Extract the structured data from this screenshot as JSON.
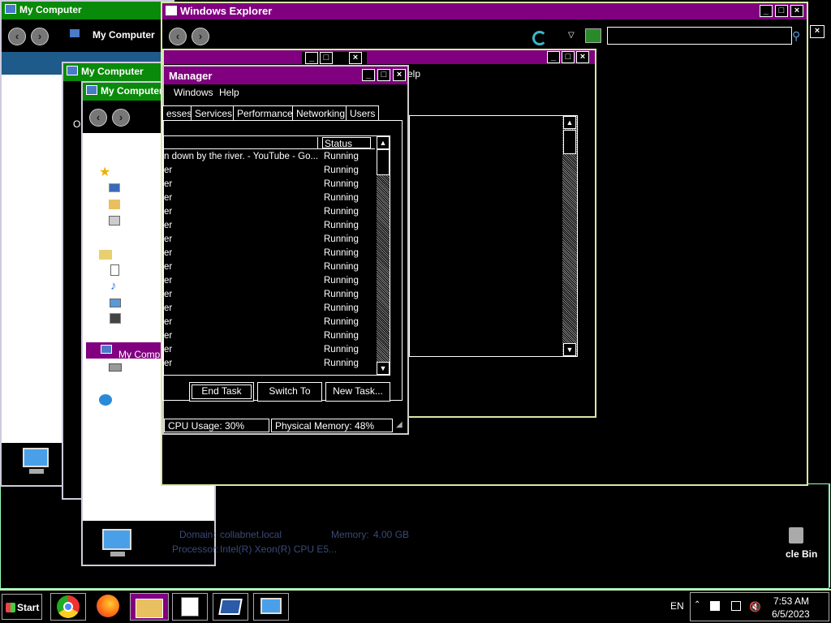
{
  "windows": {
    "back1": {
      "title": "My Computer",
      "address": "My Computer"
    },
    "back2": {
      "title": "My Computer"
    },
    "back3": {
      "title": "My Computer",
      "side_label_o": "O",
      "sidebar_selected": "My Comp"
    },
    "mid": {
      "menu_help": "elp"
    },
    "explorer": {
      "title": "Windows Explorer",
      "search_placeholder": ""
    },
    "taskmgr": {
      "title": "Manager",
      "menu": [
        "Windows",
        "Help"
      ],
      "tabs": [
        "esses",
        "Services",
        "Performance",
        "Networking",
        "Users"
      ],
      "columns": {
        "task": "",
        "status": "Status"
      },
      "rows": [
        {
          "name": "n down by the river. - YouTube - Go...",
          "status": "Running"
        },
        {
          "name": "er",
          "status": "Running"
        },
        {
          "name": "er",
          "status": "Running"
        },
        {
          "name": "er",
          "status": "Running"
        },
        {
          "name": "er",
          "status": "Running"
        },
        {
          "name": "er",
          "status": "Running"
        },
        {
          "name": "er",
          "status": "Running"
        },
        {
          "name": "er",
          "status": "Running"
        },
        {
          "name": "er",
          "status": "Running"
        },
        {
          "name": "er",
          "status": "Running"
        },
        {
          "name": "er",
          "status": "Running"
        },
        {
          "name": "er",
          "status": "Running"
        },
        {
          "name": "er",
          "status": "Running"
        },
        {
          "name": "er",
          "status": "Running"
        },
        {
          "name": "er",
          "status": "Running"
        },
        {
          "name": "er",
          "status": "Running"
        }
      ],
      "buttons": {
        "end_task": "End Task",
        "switch_to": "Switch To",
        "new_task": "New Task..."
      },
      "status_bar": {
        "cpu": "CPU Usage: 30%",
        "memory": "Physical Memory: 48%"
      }
    },
    "details": {
      "domain_label": "Domain:",
      "domain_value": "collabnet.local",
      "memory_label": "Memory:",
      "memory_value": "4.00 GB",
      "processor_label": "Processor:",
      "processor_value": "Intel(R) Xeon(R) CPU E5..."
    }
  },
  "desktop": {
    "recycle_label": "cle Bin"
  },
  "taskbar": {
    "start_label": "Start",
    "language": "EN",
    "time": "7:53 AM",
    "date": "6/5/2023",
    "apps": [
      "chrome-icon",
      "firefox-icon",
      "explorer-icon",
      "notepad-icon",
      "window-icon",
      "computer-icon"
    ]
  },
  "colors": {
    "titlebar_green": "#0a8a0a",
    "titlebar_purple": "#800080",
    "frame": "#d8e8a8"
  }
}
